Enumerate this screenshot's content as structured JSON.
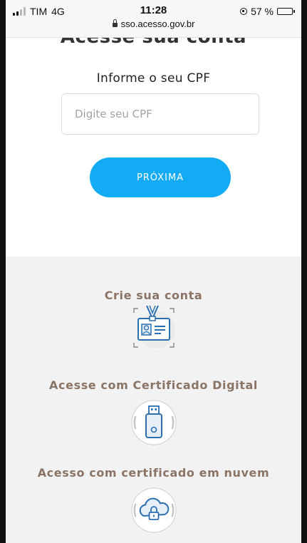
{
  "status_bar": {
    "carrier": "TIM",
    "network": "4G",
    "time": "11:28",
    "url": "sso.acesso.gov.br",
    "battery_text": "57 %",
    "battery_level": 0.57
  },
  "header": {
    "title": "Acesse sua conta"
  },
  "login_form": {
    "cpf_label": "Informe o seu CPF",
    "cpf_placeholder": "Digite seu CPF",
    "cpf_value": "",
    "next_button_label": "PRÓXIMA"
  },
  "options": {
    "create_account_label": "Crie sua conta",
    "digital_certificate_label": "Acesse com Certificado Digital",
    "cloud_certificate_label": "Acesso com certificado em nuvem"
  },
  "colors": {
    "accent": "#14abf5",
    "option_text": "#8a7466",
    "icon_blue": "#2b6fb0"
  },
  "icons": [
    "lock-icon",
    "signal-icon",
    "battery-icon",
    "id-card-icon",
    "usb-token-icon",
    "cloud-lock-icon"
  ]
}
